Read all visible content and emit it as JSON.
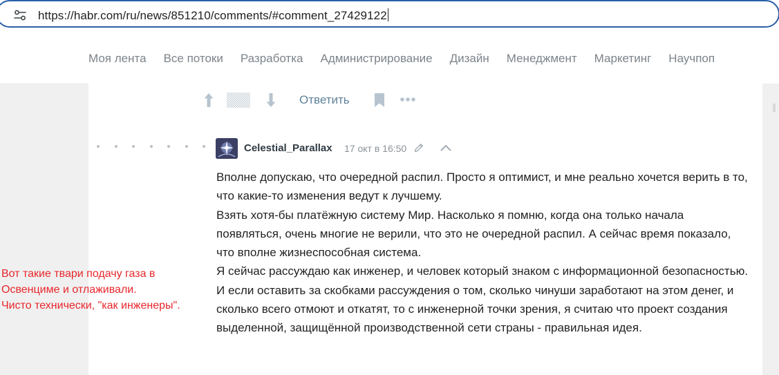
{
  "browser": {
    "url": "https://habr.com/ru/news/851210/comments/#comment_27429122",
    "site_settings_icon": "tune-icon"
  },
  "nav": {
    "items": [
      {
        "label": "Моя лента"
      },
      {
        "label": "Все потоки"
      },
      {
        "label": "Разработка"
      },
      {
        "label": "Администрирование"
      },
      {
        "label": "Дизайн"
      },
      {
        "label": "Менеджмент"
      },
      {
        "label": "Маркетинг"
      },
      {
        "label": "Научпоп"
      }
    ]
  },
  "prev_comment_actions": {
    "reply_label": "Ответить",
    "icons": [
      "arrow-up-icon",
      "rating-hidden-icon",
      "arrow-down-icon",
      "bookmark-icon",
      "more-icon"
    ]
  },
  "comment": {
    "username": "Celestial_Parallax",
    "timestamp": "17 окт в 16:50",
    "paragraphs": [
      "Вполне допускаю, что очередной распил. Просто я оптимист, и мне реально хочется верить в то, что какие-то изменения ведут к лучшему.",
      "Взять хотя-бы платёжную систему Мир. Насколько я помню, когда она только начала появляться, очень многие не верили, что это не очередной распил. А сейчас время показало, что вполне жизнеспособная система.",
      "Я сейчас рассуждаю как инженер, и человек который знаком с информационной безопасностью. И если оставить за скобками рассуждения о том, сколько чинуши заработают на этом денег, и сколько всего отмоют и откатят, то с инженерной точки зрения, я считаю что проект создания выделенной, защищённой производственной сети страны - правильная идея."
    ]
  },
  "annotation": {
    "color": "#e8262b",
    "lines": [
      "Вот такие твари подачу газа в",
      "Освенциме и отлаживали.",
      "Чисто технически, \"как инженеры\"."
    ]
  },
  "colors": {
    "nav_text": "#7b838a",
    "link": "#5e8299",
    "address_border": "#2a5fa8"
  }
}
